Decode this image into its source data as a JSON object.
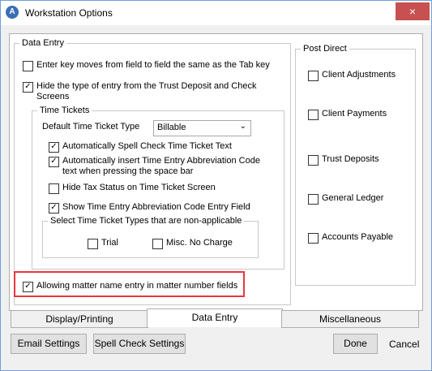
{
  "window": {
    "title": "Workstation Options",
    "close_icon": "×"
  },
  "data_entry": {
    "legend": "Data Entry",
    "enter_key": {
      "label": "Enter key moves from field to field the same as  the Tab key",
      "checked": false
    },
    "hide_type": {
      "label": "Hide the type of entry from the Trust Deposit and Check Screens",
      "checked": true
    },
    "time_tickets": {
      "legend": "Time Tickets",
      "default_type_label": "Default Time Ticket Type",
      "default_type_value": "Billable",
      "spell_check": {
        "label": "Automatically Spell Check Time Ticket Text",
        "checked": true
      },
      "auto_insert": {
        "label": "Automatically insert Time Entry Abbreviation Code text when pressing the space bar",
        "checked": true
      },
      "hide_tax": {
        "label": "Hide Tax Status on Time Ticket Screen",
        "checked": false
      },
      "show_abbrev": {
        "label": "Show Time Entry Abbreviation Code Entry Field",
        "checked": true
      },
      "non_applicable": {
        "legend": "Select Time Ticket Types that are non-applicable",
        "trial": {
          "label": "Trial",
          "checked": false
        },
        "misc": {
          "label": "Misc. No Charge",
          "checked": false
        }
      }
    },
    "allow_matter_name": {
      "label": "Allowing matter name entry in matter number fields",
      "checked": true
    }
  },
  "post_direct": {
    "legend": "Post Direct",
    "items": [
      {
        "label": "Client Adjustments",
        "checked": false
      },
      {
        "label": "Client Payments",
        "checked": false
      },
      {
        "label": "Trust Deposits",
        "checked": false
      },
      {
        "label": "General Ledger",
        "checked": false
      },
      {
        "label": "Accounts Payable",
        "checked": false
      }
    ]
  },
  "tabs": [
    {
      "label": "Display/Printing",
      "active": false
    },
    {
      "label": "Data Entry",
      "active": true
    },
    {
      "label": "Miscellaneous",
      "active": false
    }
  ],
  "buttons": {
    "email_settings": "Email Settings",
    "spell_check_settings": "Spell Check Settings",
    "done": "Done",
    "cancel": "Cancel"
  },
  "check_mark": "✓",
  "chevron": "⌄",
  "colors": {
    "highlight": "#e8363d",
    "title_icon": "#3b6fb4"
  }
}
